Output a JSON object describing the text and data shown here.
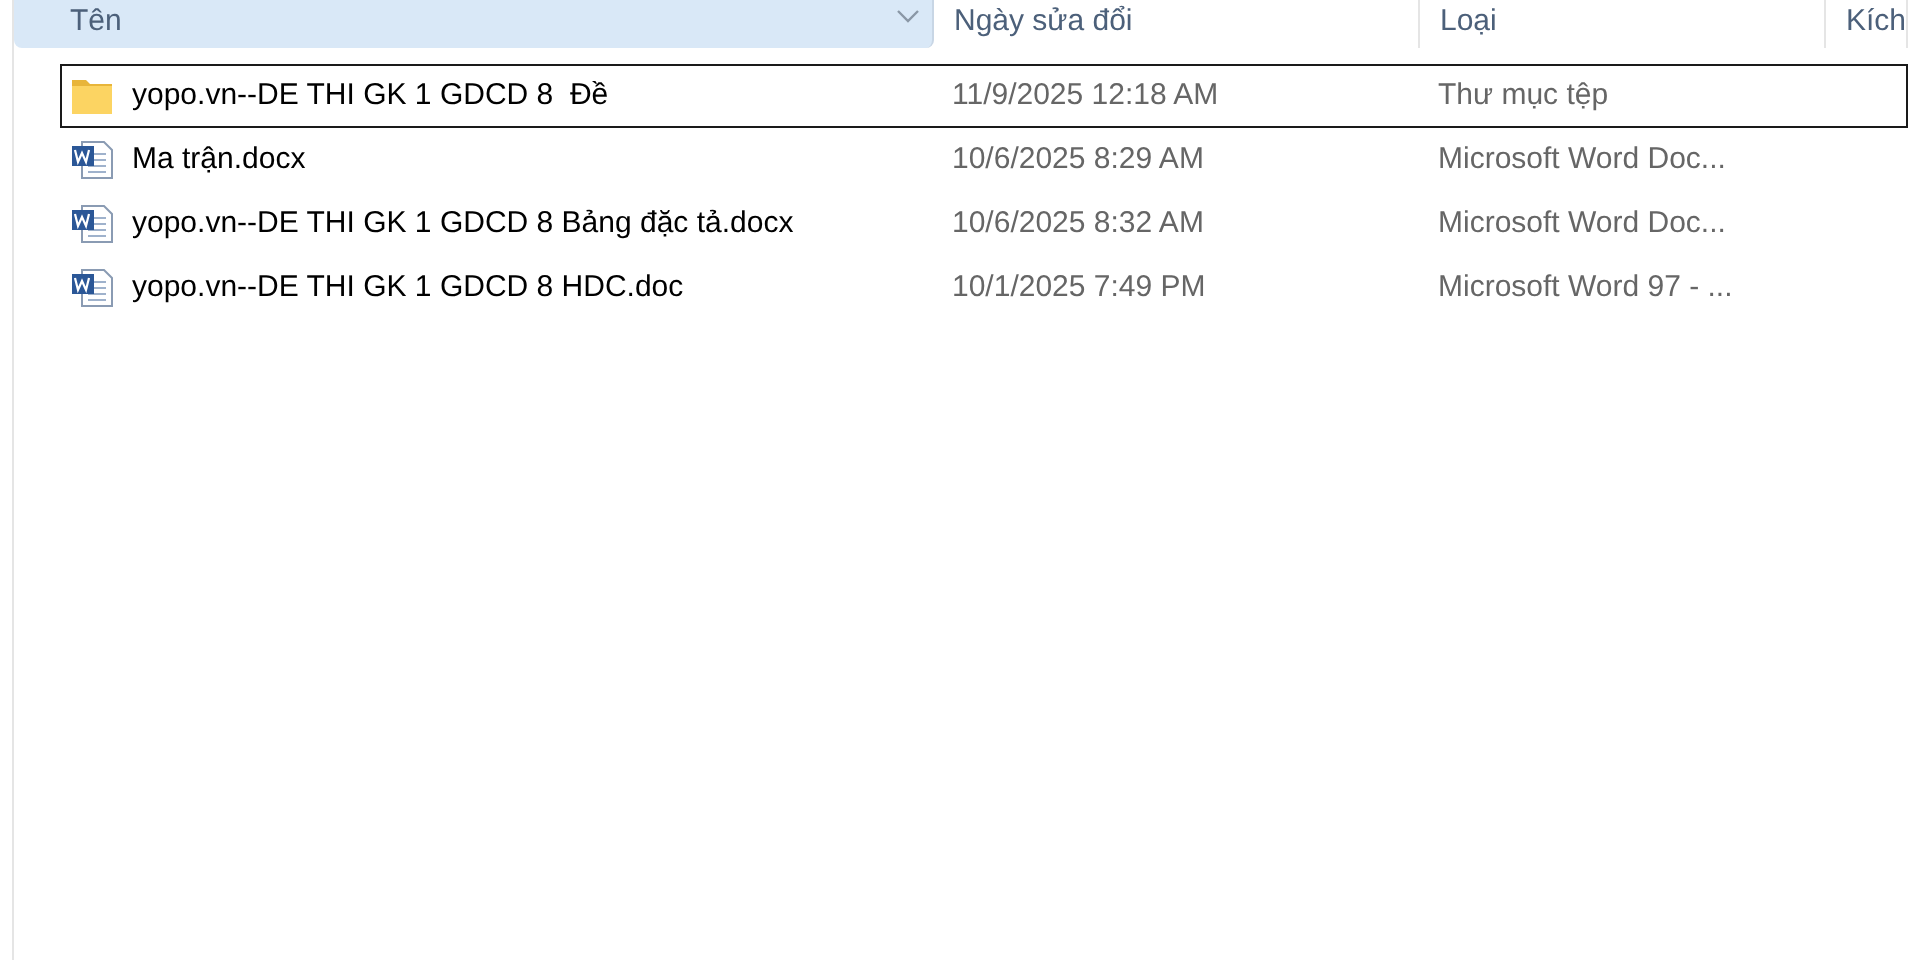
{
  "columns": [
    {
      "label": "Tên",
      "sorted": true
    },
    {
      "label": "Ngày sửa đổi",
      "sorted": false
    },
    {
      "label": "Loại",
      "sorted": false
    },
    {
      "label": "Kích",
      "sorted": false
    }
  ],
  "rows": [
    {
      "kind": "folder",
      "name": "yopo.vn--DE THI GK 1 GDCD 8  Đề",
      "modified": "11/9/2025 12:18 AM",
      "type": "Thư mục tệp",
      "focused": true
    },
    {
      "kind": "word",
      "name": "Ma trận.docx",
      "modified": "10/6/2025 8:29 AM",
      "type": "Microsoft Word Doc...",
      "focused": false
    },
    {
      "kind": "word",
      "name": "yopo.vn--DE THI GK 1 GDCD 8 Bảng đặc tả.docx",
      "modified": "10/6/2025 8:32 AM",
      "type": "Microsoft Word Doc...",
      "focused": false
    },
    {
      "kind": "word",
      "name": "yopo.vn--DE THI GK 1 GDCD 8 HDC.doc",
      "modified": "10/1/2025 7:49 PM",
      "type": "Microsoft Word 97 - ...",
      "focused": false
    }
  ]
}
